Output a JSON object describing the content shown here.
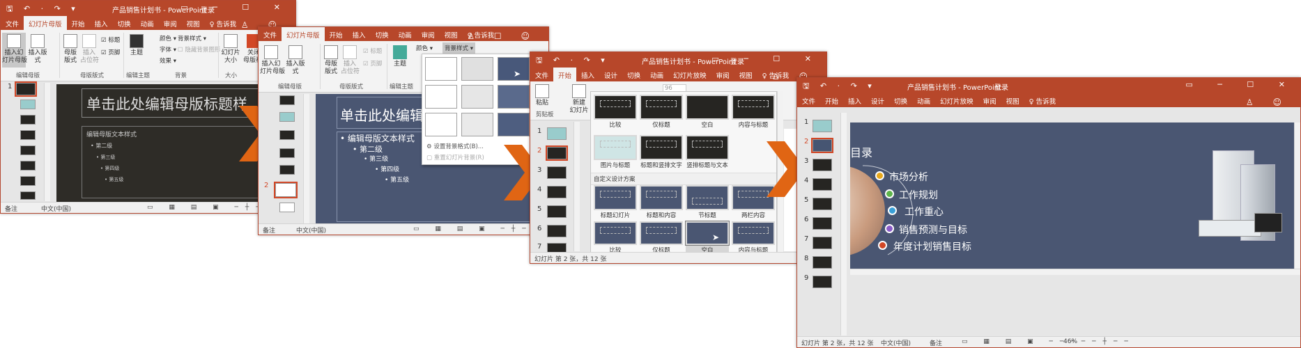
{
  "w1": {
    "qat": "🖫 ↶ · ↷ ▾",
    "title": "产品销售计划书 - PowerPoint",
    "login": "登录",
    "ctrls": "▭ ─ ☐ ✕",
    "tabs": [
      "文件",
      "幻灯片母版",
      "开始",
      "插入",
      "切换",
      "动画",
      "审阅",
      "视图",
      "♀ 告诉我"
    ],
    "buttons": {
      "insert_master": "插入幻\n灯片母版",
      "insert_layout": "插入版式",
      "master_layout": "母版\n版式",
      "insert_ph": "插入\n占位符",
      "theme": "主题",
      "slide_size": "幻灯片\n大小",
      "close_master": "关闭\n母版视图"
    },
    "checks": {
      "title": "标题",
      "footer": "页脚"
    },
    "small": {
      "colors": "颜色 ▾",
      "fonts": "字体 ▾",
      "effects": "效果 ▾",
      "bg_style": "背景样式 ▾",
      "hide_bg": "隐藏背景图形"
    },
    "groups": {
      "edit_master": "编辑母版",
      "master_layout": "母版版式",
      "edit_theme": "编辑主题",
      "background": "背景",
      "size": "大小"
    },
    "slide_numbers": [
      "1"
    ],
    "slide": {
      "title": "单击此处编辑母版标题样",
      "levels": [
        "编辑母版文本样式",
        "• 第二级",
        "• 第三级",
        "• 第四级",
        "• 第五级"
      ]
    },
    "status": {
      "notes": "备注",
      "lang": "中文(中国)"
    }
  },
  "w2": {
    "tabs": [
      "文件",
      "幻灯片母版",
      "开始",
      "插入",
      "切换",
      "动画",
      "审阅",
      "视图",
      "♀ 告诉我"
    ],
    "buttons": {
      "insert_master": "插入幻\n灯片母版",
      "insert_layout": "插入版式",
      "master_layout": "母版\n版式",
      "insert_ph": "插入\n占位符",
      "theme": "主题"
    },
    "checks": {
      "title": "标题",
      "footer": "页脚"
    },
    "small": {
      "colors": "颜色 ▾",
      "bg_style": "背景样式 ▾"
    },
    "groups": {
      "edit_master": "编辑母版",
      "master_layout": "母版版式",
      "edit_theme": "编辑主题"
    },
    "slide_numbers": [
      "2"
    ],
    "slide": {
      "title": "单击此处编辑",
      "levels": [
        "• 编辑母版文本样式",
        "• 第二级",
        "• 第三级",
        "• 第四级",
        "• 第五级"
      ]
    },
    "menu": {
      "format_bg": "设置背景格式(B)...",
      "reset_bg": "重置幻灯片背景(R)"
    },
    "status": {
      "notes": "备注",
      "lang": "中文(中国)"
    }
  },
  "w3": {
    "qat": "🖫 ↶ · ↷ ▾",
    "title": "产品销售计划书 - PowerPoint",
    "login": "登录",
    "ctrls": "▭ ─ ☐ ✕",
    "tabs": [
      "文件",
      "开始",
      "插入",
      "设计",
      "切换",
      "动画",
      "幻灯片放映",
      "审阅",
      "视图",
      "♀ 告诉我"
    ],
    "buttons": {
      "paste": "粘贴",
      "new_slide": "新建\n幻灯片"
    },
    "groups": {
      "clipboard": "剪贴板"
    },
    "font_size": "96",
    "layouts_top": [
      "比较",
      "仅标题",
      "空白",
      "内容与标题",
      "图片与标题",
      "标题和竖排文字",
      "竖排标题与文本"
    ],
    "section": "自定义设计方案",
    "layouts_custom": [
      "标题幻灯片",
      "标题和内容",
      "节标题",
      "两栏内容",
      "比较",
      "仅标题",
      "空白",
      "内容与标题"
    ],
    "slide_numbers": [
      "1",
      "2",
      "3",
      "4",
      "5",
      "6",
      "7"
    ],
    "status": "幻灯片 第 2 张，共 12 张"
  },
  "w4": {
    "qat": "🖫 ↶ · ↷ ▾",
    "title": "产品销售计划书 - PowerPoint",
    "login": "登录",
    "ctrls": "▭ ─ ☐ ✕",
    "tabs": [
      "文件",
      "开始",
      "插入",
      "设计",
      "切换",
      "动画",
      "幻灯片放映",
      "审阅",
      "视图",
      "♀ 告诉我"
    ],
    "slide_numbers": [
      "1",
      "2",
      "3",
      "4",
      "5",
      "6",
      "7",
      "8",
      "9"
    ],
    "toc_title": "目录",
    "toc": [
      "市场分析",
      "工作规划",
      "工作重心",
      "销售预测与目标",
      "年度计划销售目标"
    ],
    "toc_colors": [
      "#e8a81c",
      "#5db44a",
      "#3aa0d8",
      "#8a5bc8",
      "#d24726"
    ],
    "status": {
      "slide": "幻灯片 第 2 张，共 12 张",
      "lang": "中文(中国)",
      "notes": "备注",
      "zoom": "46%"
    }
  }
}
